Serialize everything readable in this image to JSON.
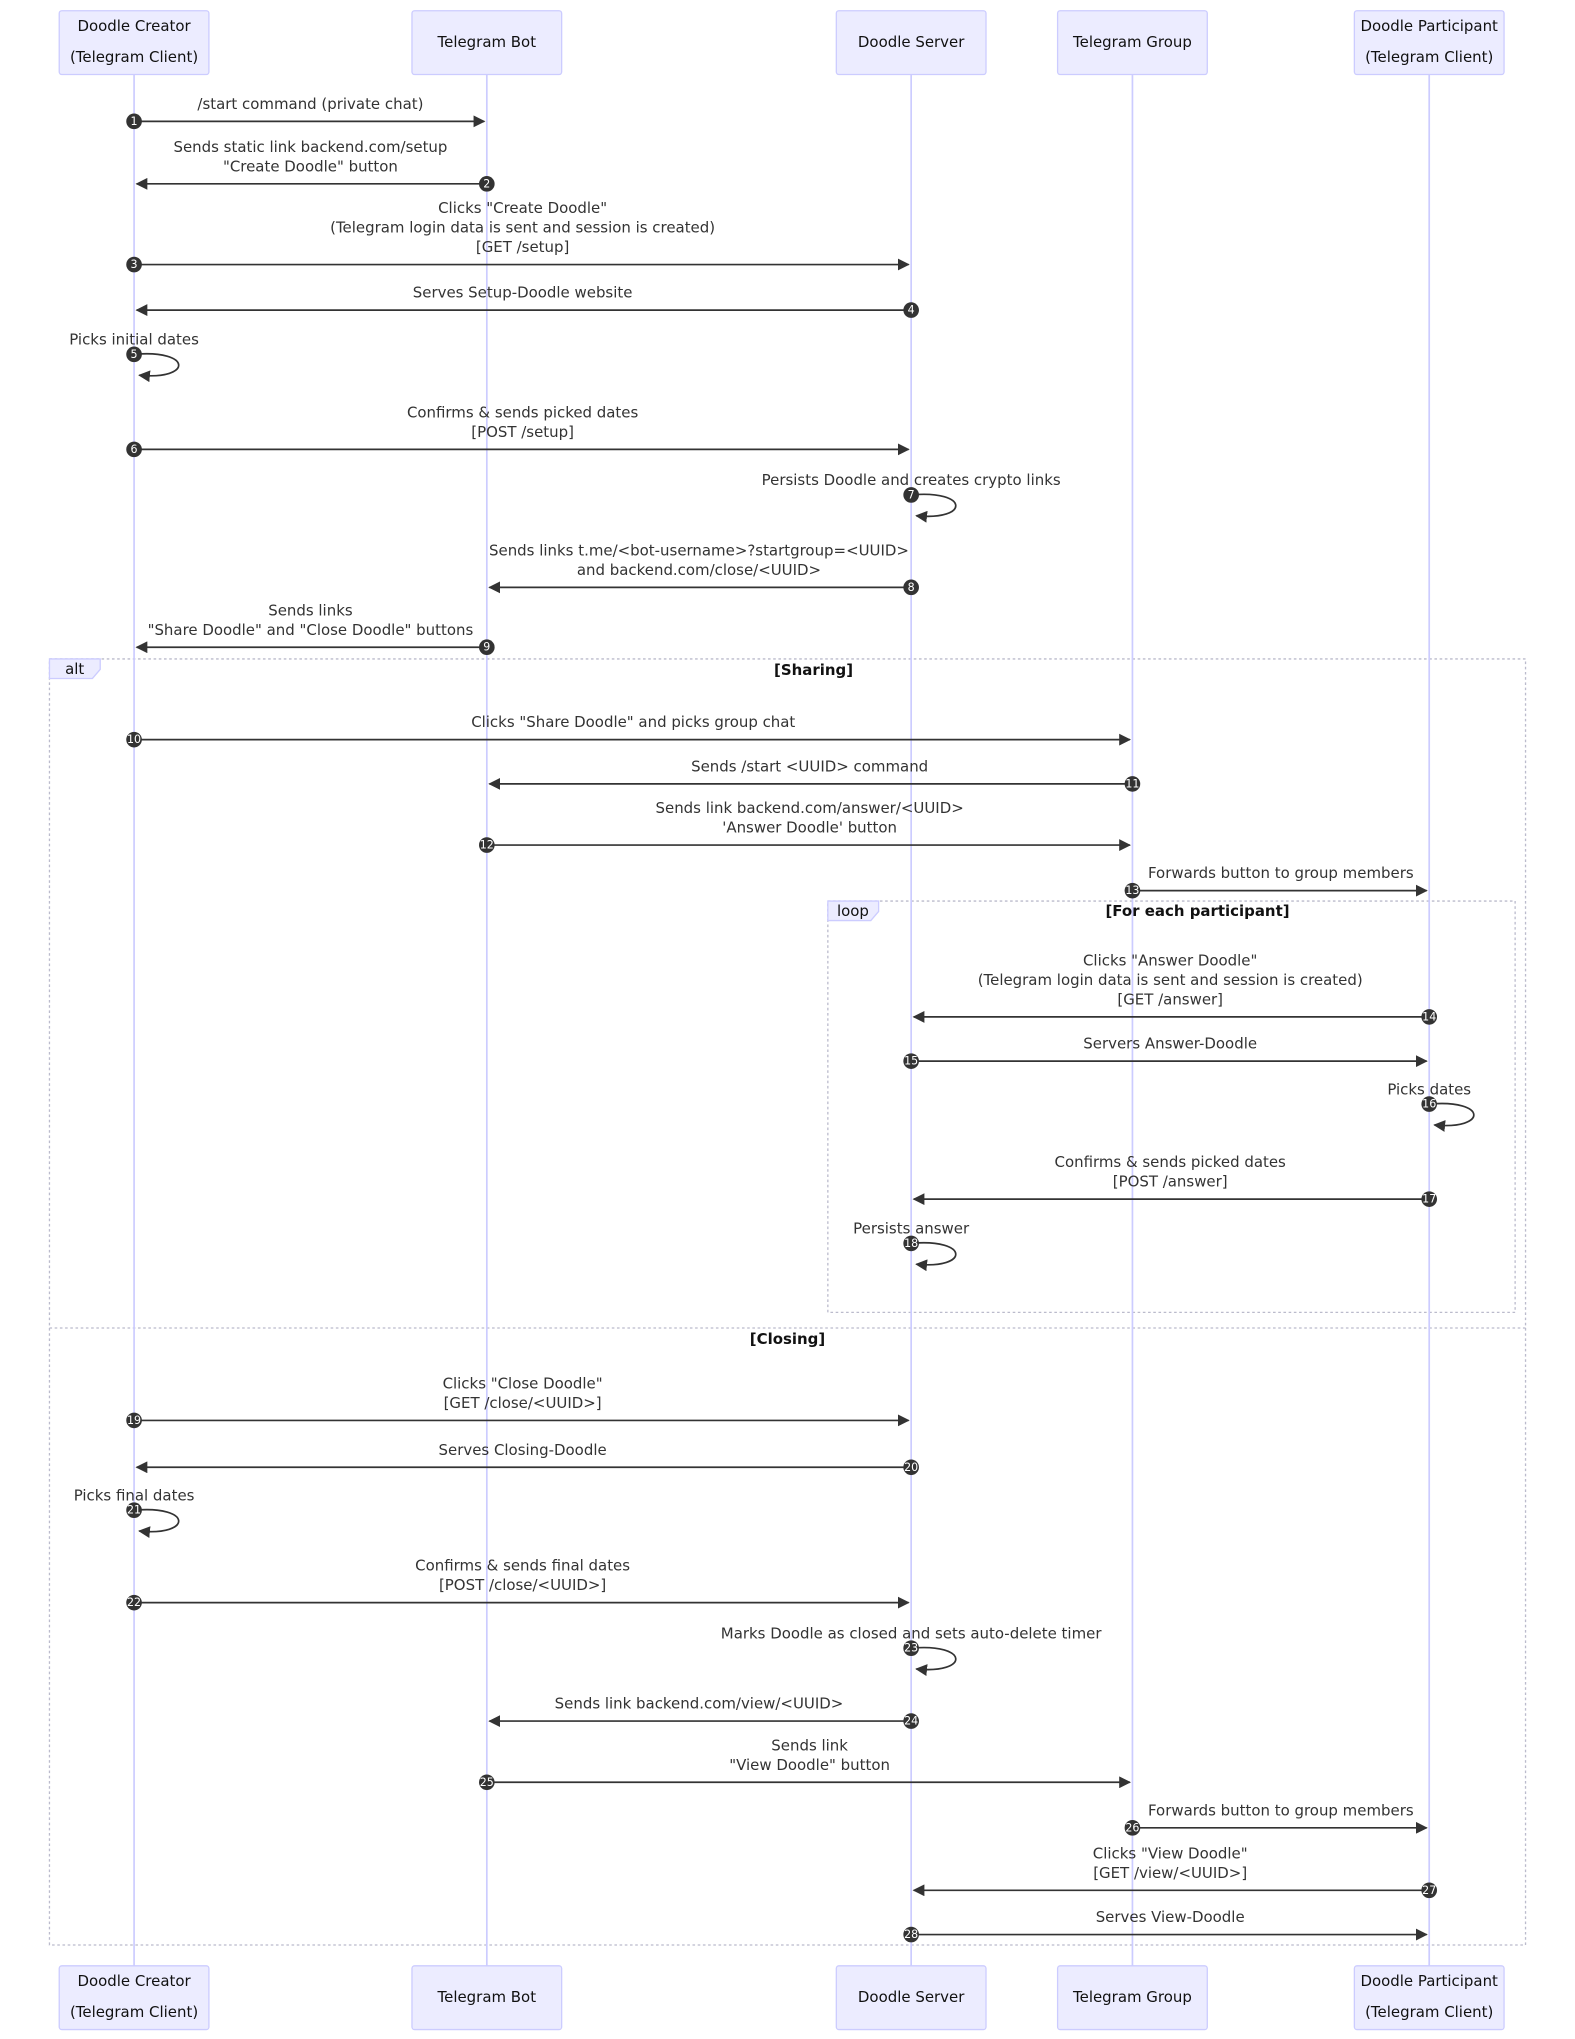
{
  "colors": {
    "actor_fill": "#ECECFF",
    "actor_stroke": "#CCCCFF",
    "lifeline": "#CCCCFF",
    "arrow": "#333333",
    "number_badge": "#333333"
  },
  "participants": [
    {
      "id": "creator",
      "lines": [
        "Doodle Creator",
        "(Telegram Client)"
      ]
    },
    {
      "id": "bot",
      "lines": [
        "Telegram Bot"
      ]
    },
    {
      "id": "server",
      "lines": [
        "Doodle Server"
      ]
    },
    {
      "id": "group",
      "lines": [
        "Telegram Group"
      ]
    },
    {
      "id": "participant",
      "lines": [
        "Doodle Participant",
        "(Telegram Client)"
      ]
    }
  ],
  "messages": [
    {
      "n": "1",
      "from": "creator",
      "to": "bot",
      "lines": [
        "/start command (private chat)"
      ]
    },
    {
      "n": "2",
      "from": "bot",
      "to": "creator",
      "lines": [
        "Sends static link backend.com/setup",
        "\"Create Doodle\" button"
      ]
    },
    {
      "n": "3",
      "from": "creator",
      "to": "server",
      "lines": [
        "Clicks \"Create Doodle\"",
        "(Telegram login data is sent and session is created)",
        "[GET /setup]"
      ]
    },
    {
      "n": "4",
      "from": "server",
      "to": "creator",
      "lines": [
        "Serves Setup-Doodle website"
      ]
    },
    {
      "n": "5",
      "from": "creator",
      "to": "creator",
      "lines": [
        "Picks initial dates"
      ]
    },
    {
      "n": "6",
      "from": "creator",
      "to": "server",
      "lines": [
        "Confirms & sends picked dates",
        "[POST /setup]"
      ]
    },
    {
      "n": "7",
      "from": "server",
      "to": "server",
      "lines": [
        "Persists Doodle and creates crypto links"
      ]
    },
    {
      "n": "8",
      "from": "server",
      "to": "bot",
      "lines": [
        "Sends links t.me/<bot-username>?startgroup=<UUID>",
        "and backend.com/close/<UUID>"
      ]
    },
    {
      "n": "9",
      "from": "bot",
      "to": "creator",
      "lines": [
        "Sends links",
        "\"Share Doodle\" and \"Close Doodle\" buttons"
      ]
    },
    {
      "n": "10",
      "from": "creator",
      "to": "group",
      "lines": [
        "Clicks \"Share Doodle\" and picks group chat"
      ]
    },
    {
      "n": "11",
      "from": "group",
      "to": "bot",
      "lines": [
        "Sends /start <UUID> command"
      ]
    },
    {
      "n": "12",
      "from": "bot",
      "to": "group",
      "lines": [
        "Sends link backend.com/answer/<UUID>",
        "'Answer Doodle' button"
      ]
    },
    {
      "n": "13",
      "from": "group",
      "to": "participant",
      "lines": [
        "Forwards button to group members"
      ]
    },
    {
      "n": "14",
      "from": "participant",
      "to": "server",
      "lines": [
        "Clicks \"Answer Doodle\"",
        "(Telegram login data is sent and session is created)",
        "[GET /answer]"
      ]
    },
    {
      "n": "15",
      "from": "server",
      "to": "participant",
      "lines": [
        "Servers Answer-Doodle"
      ]
    },
    {
      "n": "16",
      "from": "participant",
      "to": "participant",
      "lines": [
        "Picks dates"
      ]
    },
    {
      "n": "17",
      "from": "participant",
      "to": "server",
      "lines": [
        "Confirms & sends picked dates",
        "[POST /answer]"
      ]
    },
    {
      "n": "18",
      "from": "server",
      "to": "server",
      "lines": [
        "Persists answer"
      ]
    },
    {
      "n": "19",
      "from": "creator",
      "to": "server",
      "lines": [
        "Clicks \"Close Doodle\"",
        "[GET /close/<UUID>]"
      ]
    },
    {
      "n": "20",
      "from": "server",
      "to": "creator",
      "lines": [
        "Serves Closing-Doodle"
      ]
    },
    {
      "n": "21",
      "from": "creator",
      "to": "creator",
      "lines": [
        "Picks final dates"
      ]
    },
    {
      "n": "22",
      "from": "creator",
      "to": "server",
      "lines": [
        "Confirms & sends final dates",
        "[POST /close/<UUID>]"
      ]
    },
    {
      "n": "23",
      "from": "server",
      "to": "server",
      "lines": [
        "Marks Doodle as closed and sets auto-delete timer"
      ]
    },
    {
      "n": "24",
      "from": "server",
      "to": "bot",
      "lines": [
        "Sends link backend.com/view/<UUID>"
      ]
    },
    {
      "n": "25",
      "from": "bot",
      "to": "group",
      "lines": [
        "Sends link",
        "\"View Doodle\" button"
      ]
    },
    {
      "n": "26",
      "from": "group",
      "to": "participant",
      "lines": [
        "Forwards button to group members"
      ]
    },
    {
      "n": "27",
      "from": "participant",
      "to": "server",
      "lines": [
        "Clicks \"View Doodle\"",
        "[GET /view/<UUID>]"
      ]
    },
    {
      "n": "28",
      "from": "server",
      "to": "participant",
      "lines": [
        "Serves View-Doodle"
      ]
    }
  ],
  "frames": {
    "alt": {
      "kind": "alt",
      "condition": "[Sharing]",
      "else_condition": "[Closing]"
    },
    "loop": {
      "kind": "loop",
      "condition": "[For each participant]"
    }
  }
}
